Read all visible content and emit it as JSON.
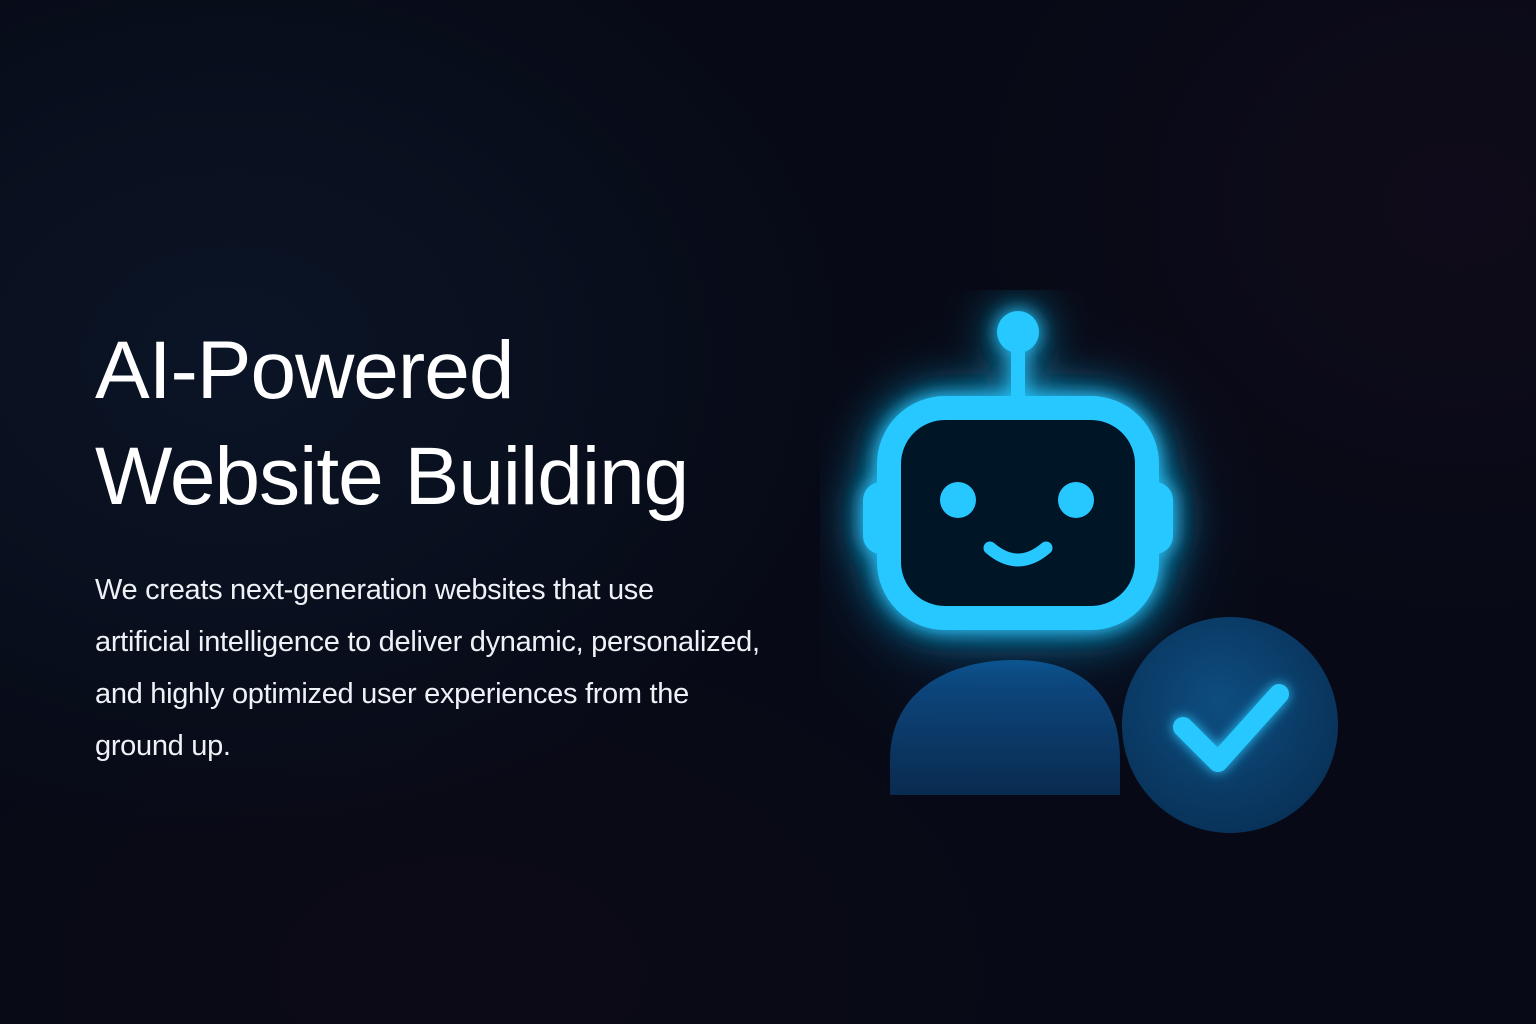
{
  "hero": {
    "title_lines": [
      "AI-Powered",
      "Website Building"
    ],
    "description_lines": [
      "We creats next-generation websites that use",
      "artificial intelligence to deliver dynamic, personalized,",
      "and highly optimized user experiences from the",
      "ground up."
    ]
  },
  "illustration": {
    "icons": [
      "robot-icon",
      "checkmark-icon"
    ],
    "colors": {
      "accent": "#27c8ff",
      "accent_glow": "#0f8fe0",
      "badge_fill": "#0b3d66",
      "body_fill": "#0a3560",
      "background": "#070a16"
    }
  }
}
